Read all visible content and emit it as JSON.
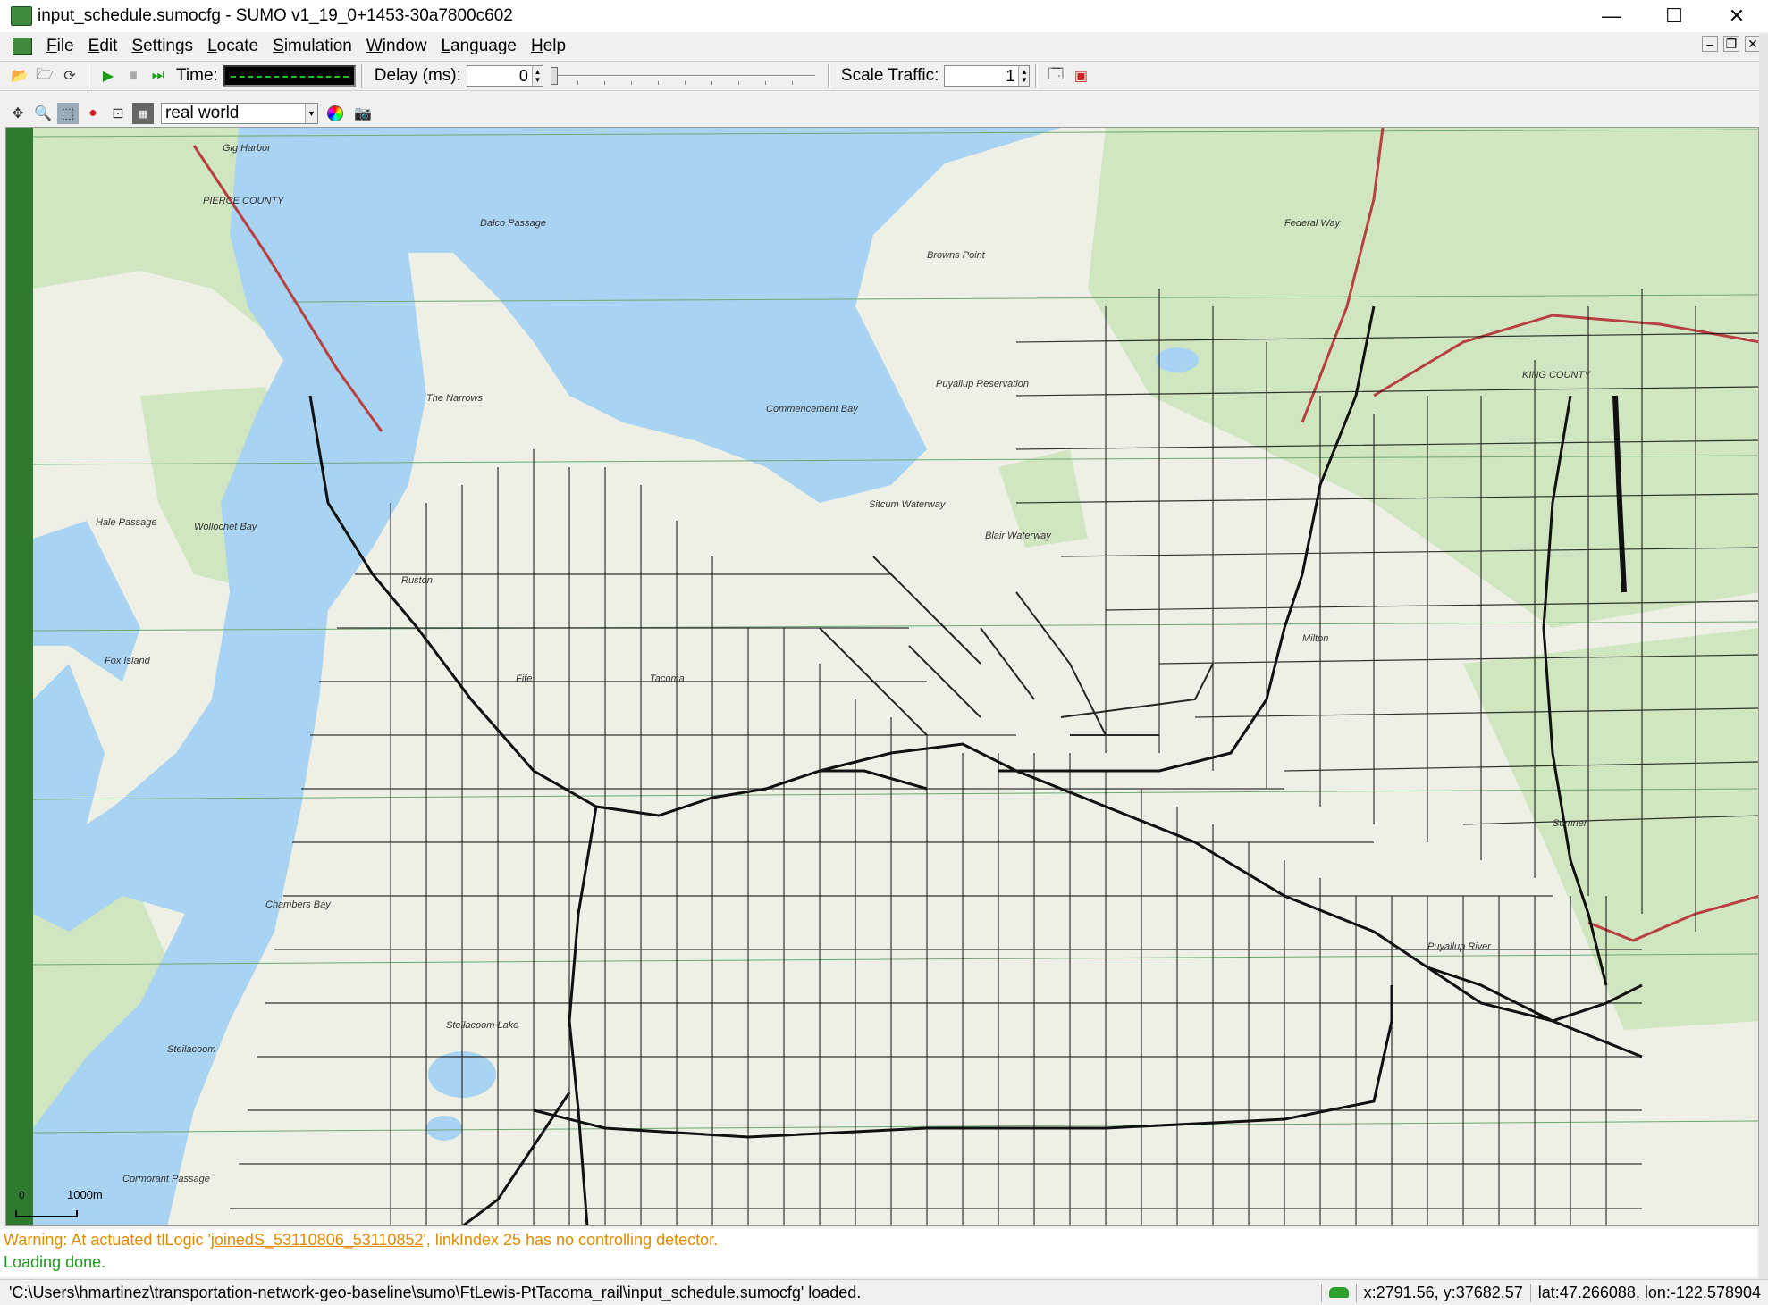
{
  "window": {
    "title": "input_schedule.sumocfg - SUMO v1_19_0+1453-30a7800c602",
    "controls": [
      "—",
      "☐",
      "✕"
    ]
  },
  "menu": [
    "File",
    "Edit",
    "Settings",
    "Locate",
    "Simulation",
    "Window",
    "Language",
    "Help"
  ],
  "toolbar": {
    "time_label": "Time:",
    "delay_label": "Delay (ms):",
    "delay_value": "0",
    "scale_label": "Scale Traffic:",
    "scale_value": "1"
  },
  "view_toolbar": {
    "scheme": "real world"
  },
  "map": {
    "scale_zero": "0",
    "scale_length": "1000m",
    "labels": [
      "PIERCE COUNTY",
      "Dalco Passage",
      "The Narrows",
      "Commencement Bay",
      "Puyallup Reservation",
      "Federal Way",
      "Hale Passage",
      "Wollochet Bay",
      "Tacoma",
      "Fife",
      "Milton",
      "Sitcum Waterway",
      "Blair Waterway",
      "KING COUNTY",
      "Chambers Bay",
      "Steilacoom Lake",
      "Puyallup River",
      "Sumner",
      "Cormorant Passage",
      "Steilacoom",
      "Ruston",
      "Fox Island",
      "Gig Harbor",
      "Browns Point"
    ]
  },
  "messages": {
    "warning_prefix": "Warning: At actuated tlLogic '",
    "warning_link": "joinedS_53110806_53110852",
    "warning_suffix": "', linkIndex 25 has no controlling detector.",
    "loaded": "Loading done."
  },
  "status": {
    "path": "'C:\\Users\\hmartinez\\transportation-network-geo-baseline\\sumo\\FtLewis-PtTacoma_rail\\input_schedule.sumocfg' loaded.",
    "xy": "x:2791.56, y:37682.57",
    "latlon": "lat:47.266088, lon:-122.578904"
  },
  "colors": {
    "water": "#a9d3f2",
    "land": "#eef0e6",
    "park": "#cfe6c0",
    "road": "#111111",
    "gridline": "#2a8a2a",
    "warning": "#e08a00",
    "ok": "#1d9a1d"
  }
}
